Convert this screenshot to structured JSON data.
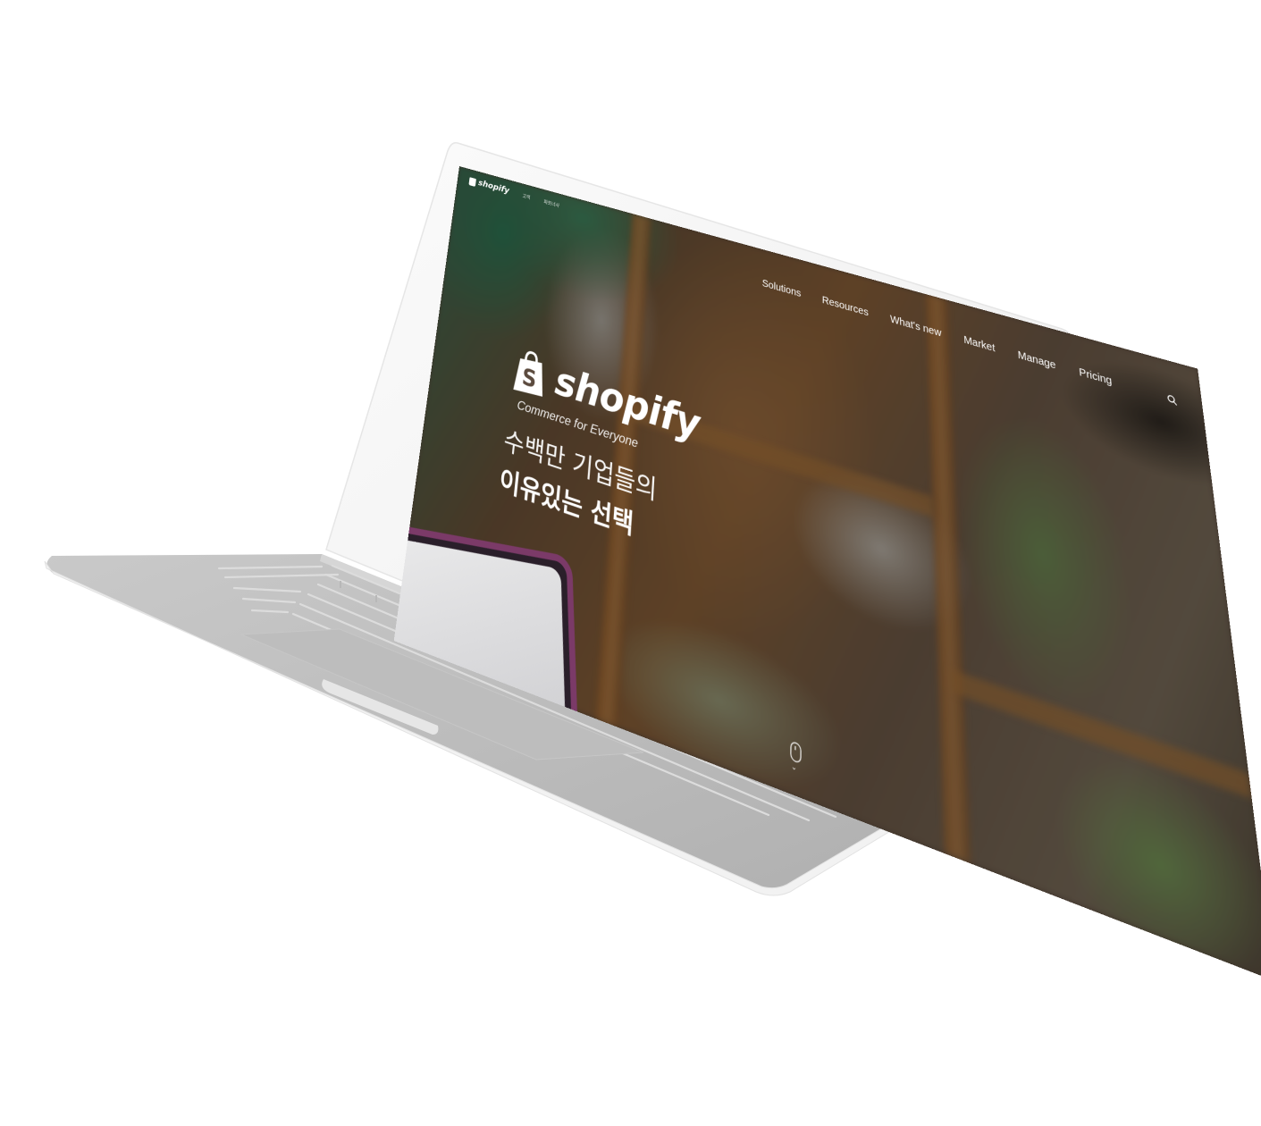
{
  "topbar": {
    "brand": "shopify",
    "links": [
      "고객",
      "파트너사"
    ]
  },
  "nav": {
    "items": [
      "Solutions",
      "Resources",
      "What's new",
      "Market",
      "Manage",
      "Pricing"
    ],
    "search_icon": "search-icon"
  },
  "hero": {
    "brand": "shopify",
    "tagline": "Commerce for Everyone",
    "headline_line1": "수백만 기업들의",
    "headline_line2": "이유있는 선택"
  },
  "icons": {
    "logo": "shopify-bag-icon",
    "scroll": "scroll-mouse-icon",
    "scroll_arrow": "chevron-down-icon"
  },
  "colors": {
    "laptop_body": "#b3b3b3",
    "laptop_frame": "#f5f5f5",
    "screen_overlay": "#000000"
  }
}
